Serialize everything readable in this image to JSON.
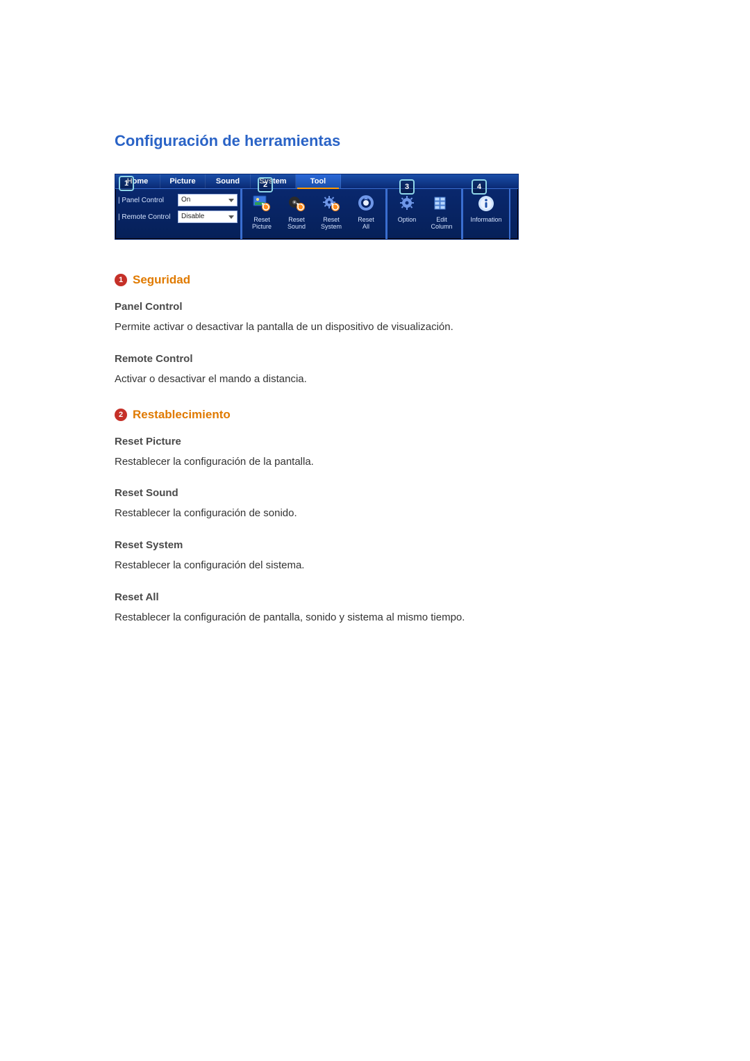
{
  "page_title": "Configuración de herramientas",
  "toolbar": {
    "tabs": [
      {
        "label": "Home"
      },
      {
        "label": "Picture"
      },
      {
        "label": "Sound"
      },
      {
        "label": "System"
      },
      {
        "label": "Tool"
      }
    ],
    "active_tab_index": 4,
    "controls": [
      {
        "label": "Panel Control",
        "value": "On"
      },
      {
        "label": "Remote Control",
        "value": "Disable"
      }
    ],
    "reset_buttons": [
      {
        "label": "Reset\nPicture"
      },
      {
        "label": "Reset\nSound"
      },
      {
        "label": "Reset\nSystem"
      },
      {
        "label": "Reset\nAll"
      }
    ],
    "config_buttons": [
      {
        "label": "Option"
      },
      {
        "label": "Edit\nColumn"
      }
    ],
    "info_button": {
      "label": "Information"
    },
    "callouts": {
      "c1": "1",
      "c2": "2",
      "c3": "3",
      "c4": "4"
    }
  },
  "sections": [
    {
      "bullet": "1",
      "title": "Seguridad",
      "items": [
        {
          "title": "Panel Control",
          "desc": "Permite activar o desactivar la pantalla de un dispositivo de visualización."
        },
        {
          "title": "Remote Control",
          "desc": "Activar o desactivar el mando a distancia."
        }
      ]
    },
    {
      "bullet": "2",
      "title": "Restablecimiento",
      "items": [
        {
          "title": "Reset Picture",
          "desc": "Restablecer la configuración de la pantalla."
        },
        {
          "title": "Reset Sound",
          "desc": "Restablecer la configuración de sonido."
        },
        {
          "title": "Reset System",
          "desc": "Restablecer la configuración del sistema."
        },
        {
          "title": "Reset All",
          "desc": "Restablecer la configuración de pantalla, sonido y sistema al mismo tiempo."
        }
      ]
    }
  ]
}
